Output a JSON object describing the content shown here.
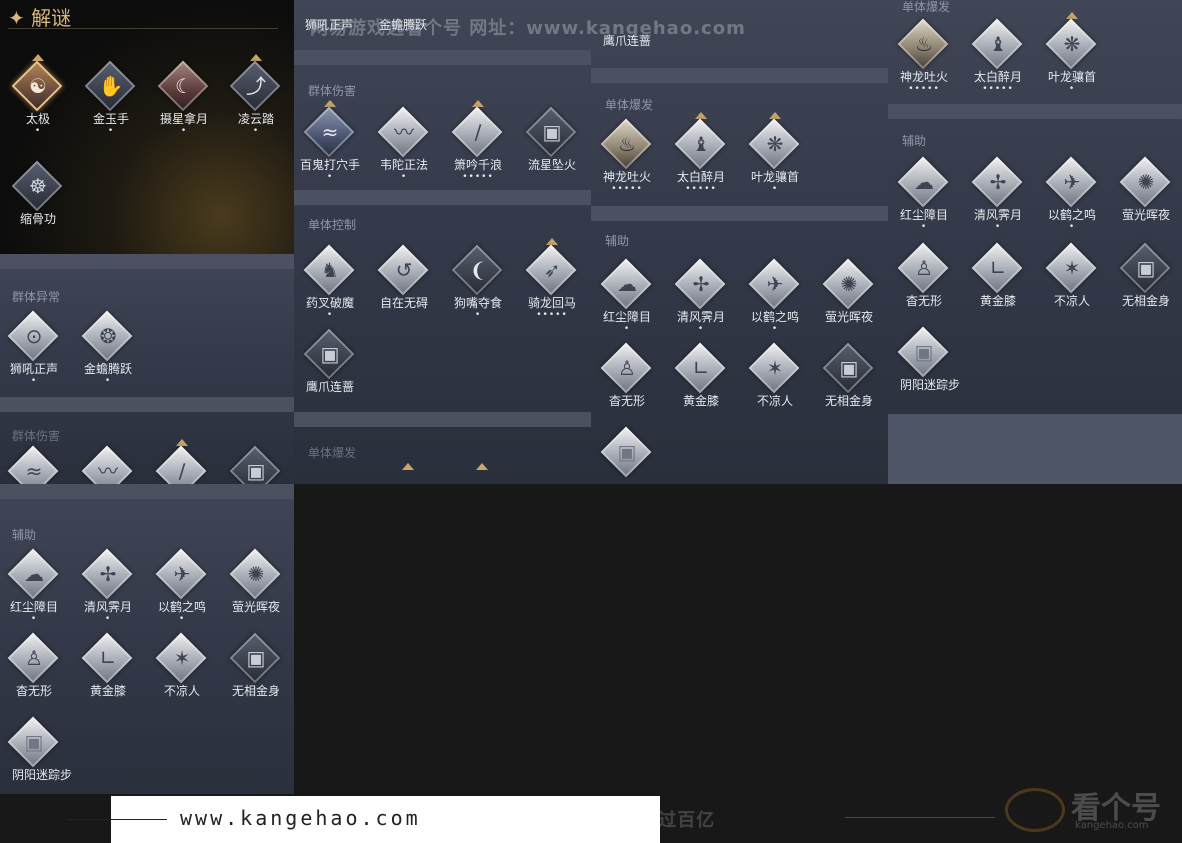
{
  "p1": {
    "title": "✦ 解谜",
    "r1": [
      "太极",
      "金玉手",
      "摄星拿月",
      "凌云踏"
    ],
    "r2": [
      "缩骨功"
    ]
  },
  "p2": {
    "s1": "群体异常",
    "r1": [
      "狮吼正声",
      "金蟾腾跃"
    ],
    "s2": "群体伤害",
    "r2_dots": [
      "•••••",
      "•••••",
      "•",
      ""
    ]
  },
  "p3": {
    "s1": "辅助",
    "r1": [
      "红尘障目",
      "清风霁月",
      "以鹤之鸣",
      "萤光晖夜"
    ],
    "r2": [
      "杳无形",
      "黄金膝",
      "不凉人",
      "无相金身"
    ],
    "r3": [
      "阴阳迷踪步"
    ]
  },
  "c2": {
    "top": [
      "狮吼正声",
      "金蟾腾跃"
    ],
    "s1": "群体伤害",
    "r1": [
      "百鬼打穴手",
      "韦陀正法",
      "箫吟千浪",
      "流星坠火"
    ],
    "s2": "单体控制",
    "r2": [
      "药叉破魔",
      "自在无碍",
      "狗嘴夺食",
      "骑龙回马"
    ],
    "r3": [
      "鹰爪连蔷"
    ],
    "s3": "单体爆发"
  },
  "c3": {
    "top": [
      "鹰爪连蔷"
    ],
    "s1": "单体爆发",
    "r1": [
      "神龙吐火",
      "太白醉月",
      "叶龙骧首"
    ],
    "s2": "辅助",
    "r2": [
      "红尘障目",
      "清风霁月",
      "以鹤之鸣",
      "萤光晖夜"
    ],
    "r3": [
      "杳无形",
      "黄金膝",
      "不凉人",
      "无相金身"
    ]
  },
  "c4": {
    "s0": "单体爆发",
    "r0": [
      "神龙吐火",
      "太白醉月",
      "叶龙骧首"
    ],
    "s1": "辅助",
    "r1": [
      "红尘障目",
      "清风霁月",
      "以鹤之鸣",
      "萤光晖夜"
    ],
    "r2": [
      "杳无形",
      "黄金膝",
      "不凉人",
      "无相金身"
    ],
    "r3": [
      "阴阳迷踪步"
    ]
  },
  "watermarks": {
    "top": "网易游戏选看个号   网址：www.kangehao.com",
    "bottom": "看个号专业网易游戏八年   年交易额过百亿"
  },
  "footer": {
    "url": "www.kangehao.com",
    "logo": "看个号",
    "logo_sub": "kangehao.com"
  },
  "icons": [
    "yin-yang-icon",
    "hand-icon",
    "moon-icon",
    "foot-icon",
    "figure-icon",
    "wave-icon",
    "dragon-icon",
    "meteor-icon",
    "demon-icon",
    "hook-icon",
    "fist-icon",
    "wind-icon",
    "crane-icon",
    "firefly-icon",
    "shadow-icon",
    "knee-icon",
    "shield-icon"
  ],
  "colors": {
    "accent": "#d8b57a",
    "panel": "#3a404f",
    "text": "#e7e9ee",
    "section": "#8f96a6"
  }
}
